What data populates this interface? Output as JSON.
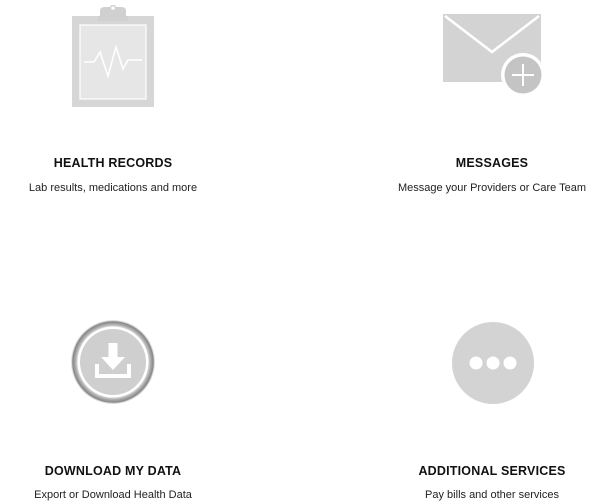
{
  "tiles": {
    "health_records": {
      "title": "HEALTH RECORDS",
      "subtitle": "Lab results, medications and more",
      "icon": "clipboard-heartbeat-icon"
    },
    "messages": {
      "title": "MESSAGES",
      "subtitle": "Message your Providers or Care Team",
      "icon": "envelope-plus-icon"
    },
    "download_my_data": {
      "title": "DOWNLOAD MY DATA",
      "subtitle": "Export or Download Health Data",
      "icon": "download-icon"
    },
    "additional_services": {
      "title": "ADDITIONAL SERVICES",
      "subtitle": "Pay bills and other services",
      "icon": "more-options-icon"
    }
  },
  "colors": {
    "icon_gray": "#d3d3d3",
    "icon_dark_gray": "#c4c4c4",
    "text": "#111111",
    "background": "#ffffff"
  }
}
